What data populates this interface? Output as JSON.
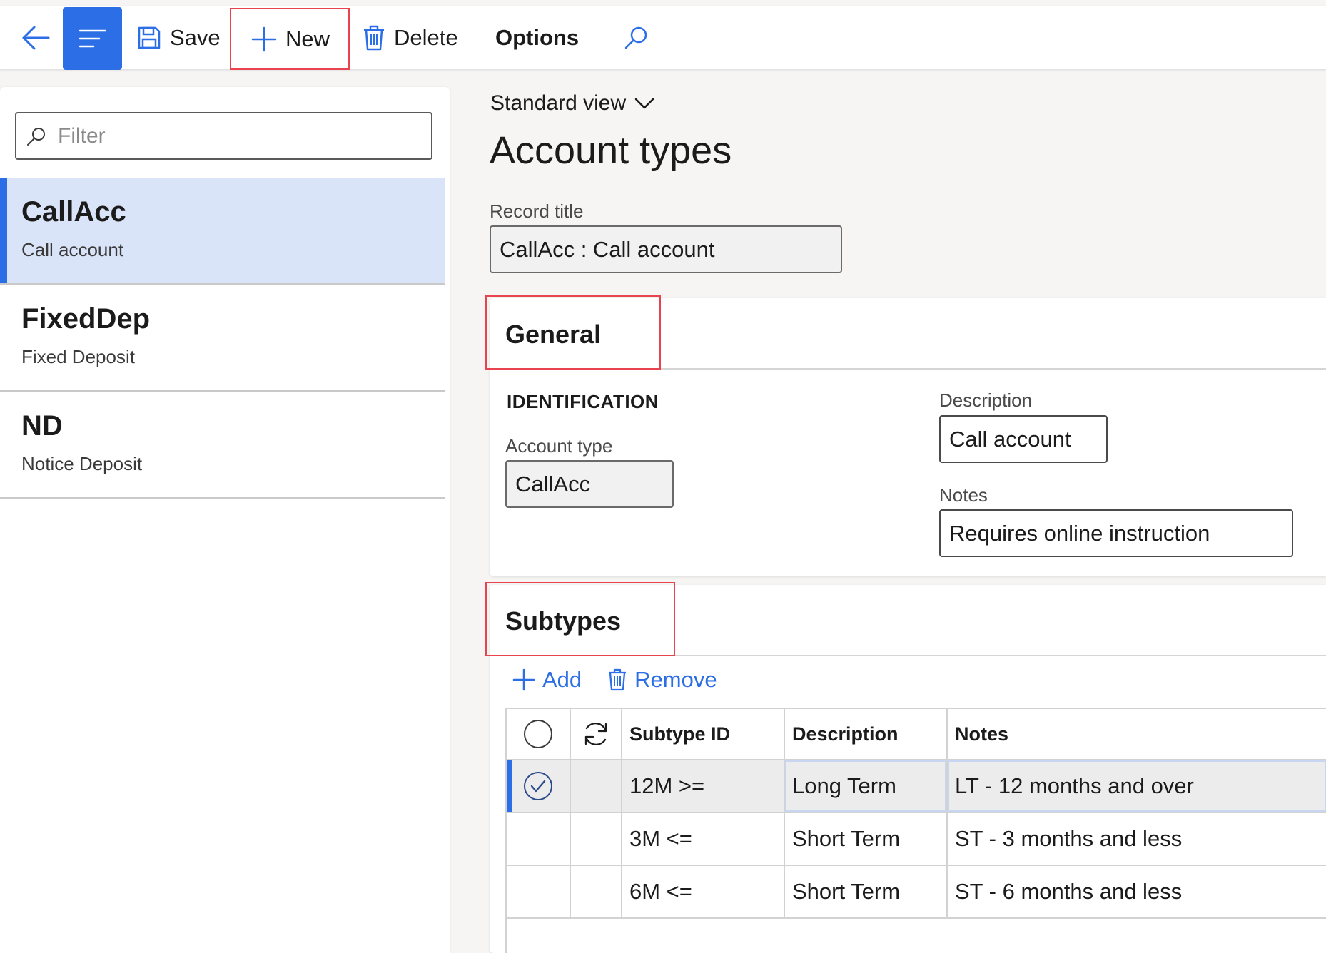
{
  "toolbar": {
    "save_label": "Save",
    "new_label": "New",
    "delete_label": "Delete",
    "options_label": "Options"
  },
  "left_panel": {
    "filter_placeholder": "Filter",
    "items": [
      {
        "title": "CallAcc",
        "subtitle": "Call account",
        "selected": true
      },
      {
        "title": "FixedDep",
        "subtitle": "Fixed Deposit",
        "selected": false
      },
      {
        "title": "ND",
        "subtitle": "Notice Deposit",
        "selected": false
      }
    ]
  },
  "main": {
    "view_label": "Standard view",
    "page_title": "Account types",
    "record_title_label": "Record title",
    "record_title_value": "CallAcc : Call account"
  },
  "general": {
    "section_title": "General",
    "group_title": "IDENTIFICATION",
    "account_type_label": "Account type",
    "account_type_value": "CallAcc",
    "description_label": "Description",
    "description_value": "Call account",
    "notes_label": "Notes",
    "notes_value": "Requires online instruction"
  },
  "subtypes": {
    "section_title": "Subtypes",
    "add_label": "Add",
    "remove_label": "Remove",
    "columns": {
      "id": "Subtype ID",
      "description": "Description",
      "notes": "Notes"
    },
    "rows": [
      {
        "id": "12M >=",
        "description": "Long Term",
        "notes": "LT - 12 months and over"
      },
      {
        "id": "3M <=",
        "description": "Short Term",
        "notes": "ST - 3 months and less"
      },
      {
        "id": "6M <=",
        "description": "Short Term",
        "notes": "ST - 6 months and less"
      }
    ]
  },
  "colors": {
    "accent": "#2b6ee5",
    "selected_row": "#dae4f8",
    "highlight_border": "#e8434f"
  },
  "icons": [
    "back-arrow-icon",
    "menu-icon",
    "save-icon",
    "plus-icon",
    "trash-icon",
    "search-icon",
    "chevron-down-icon",
    "refresh-icon",
    "checkmark-circle-icon"
  ]
}
